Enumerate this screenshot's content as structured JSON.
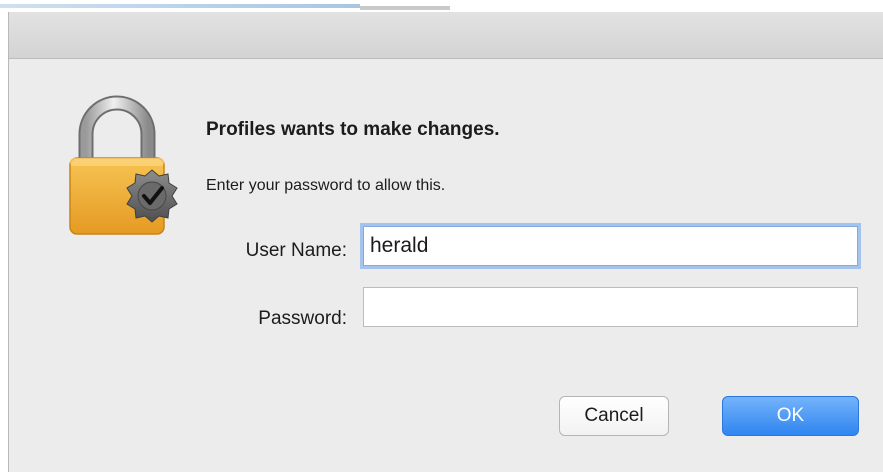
{
  "dialog": {
    "heading": "Profiles wants to make changes.",
    "message": "Enter your password to allow this.",
    "icon": "lock-with-checkmark-badge-icon"
  },
  "form": {
    "username_label": "User Name:",
    "username_value": "herald",
    "password_label": "Password:",
    "password_value": ""
  },
  "buttons": {
    "cancel_label": "Cancel",
    "ok_label": "OK"
  },
  "colors": {
    "dialog_background": "#ececec",
    "lock_gold": "#f3b63a",
    "focus_ring": "#a5c4ed",
    "ok_button": "#3a8cf2"
  }
}
